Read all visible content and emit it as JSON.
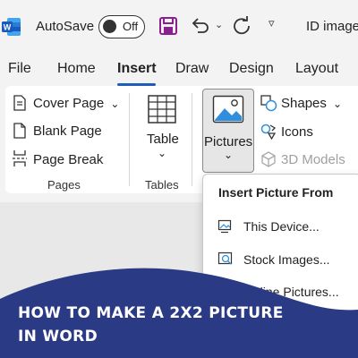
{
  "titlebar": {
    "app_icon": "word-logo-icon",
    "autosave_label": "AutoSave",
    "autosave_state": "Off",
    "doc_title": "ID image",
    "brand_color": "#185abd"
  },
  "tabs": [
    {
      "label": "File"
    },
    {
      "label": "Home"
    },
    {
      "label": "Insert",
      "active": true
    },
    {
      "label": "Draw"
    },
    {
      "label": "Design"
    },
    {
      "label": "Layout"
    }
  ],
  "ribbon": {
    "pages": {
      "items": [
        "Cover Page",
        "Blank Page",
        "Page Break"
      ],
      "group_label": "Pages"
    },
    "tables": {
      "button_label": "Table",
      "group_label": "Tables"
    },
    "illustrations": {
      "pictures_label": "Pictures",
      "shapes_label": "Shapes",
      "icons_label": "Icons",
      "models_label": "3D Models"
    }
  },
  "dropdown": {
    "header": "Insert Picture From",
    "items": [
      "This Device...",
      "Stock Images...",
      "Online Pictures..."
    ]
  },
  "banner": {
    "line1": "HOW TO MAKE A 2X2 PICTURE",
    "line2": "IN WORD",
    "color": "#2b3a85"
  }
}
